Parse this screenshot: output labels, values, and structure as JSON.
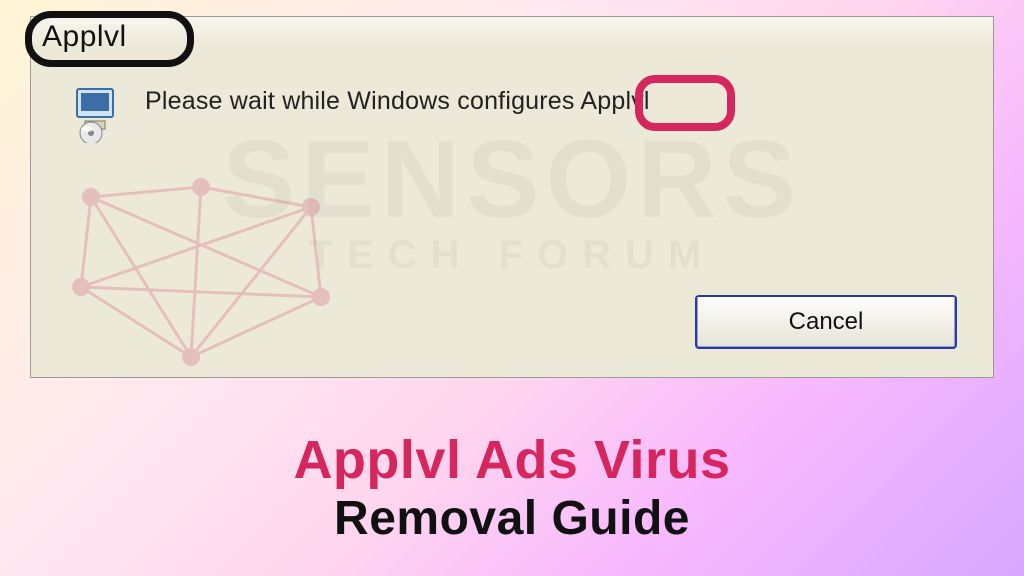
{
  "dialog": {
    "title": "Applvl",
    "message_prefix": "Please wait while Windows configures ",
    "message_product": "Applvl",
    "cancel_label": "Cancel"
  },
  "watermark": {
    "line1": "SENSORS",
    "line2": "TECH FORUM"
  },
  "headline": {
    "line1": "Applvl Ads Virus",
    "line2": "Removal Guide"
  },
  "colors": {
    "accent_pink": "#d6265e",
    "dialog_bg": "#ece9d8",
    "button_border": "#2c3a9a"
  },
  "icons": {
    "installer": "installer-icon"
  }
}
